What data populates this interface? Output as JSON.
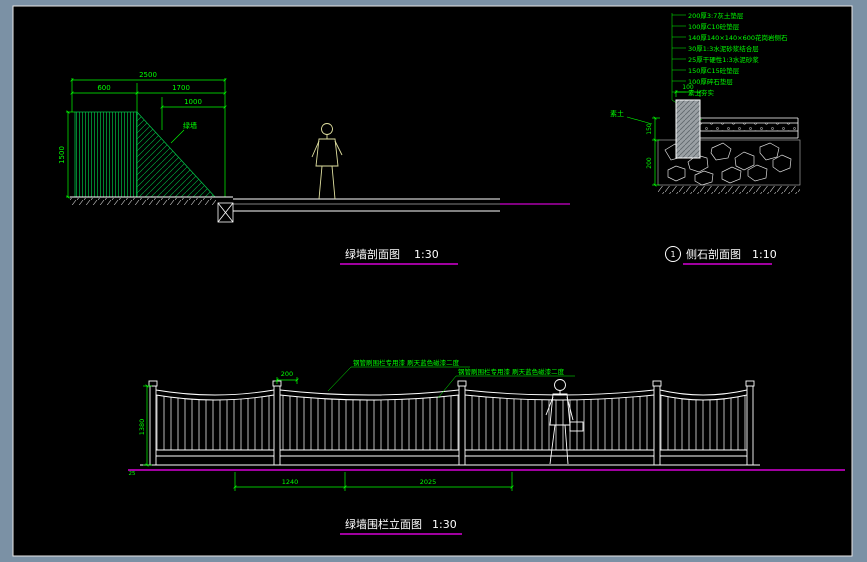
{
  "colors": {
    "frame": "#7b91a5",
    "canvas": "#000000",
    "geometry": "#ffffff",
    "dimension_green": "#00ff00",
    "hatch_green": "#00bb44",
    "baseline_magenta": "#ff00ff",
    "person_yellow": "#e0e0a0"
  },
  "wall": {
    "caption": "绿墙剖面图",
    "scale": "1:30",
    "label": "绿墙",
    "dims": {
      "total": "2500",
      "left_seg": "600",
      "right_seg": "1700",
      "slope": "1000",
      "height": "1500"
    }
  },
  "curb": {
    "caption": "侧石剖面图",
    "scale": "1:10",
    "bubble": "1",
    "soil_label": "素土",
    "dims": {
      "stone_top": "100",
      "layer_upper": "150",
      "layer_lower": "200"
    },
    "notes": [
      "200厚3:7灰土垫层",
      "100厚C10砼垫层",
      "140厚140×140×600花岗岩侧石",
      "30厚1:3水泥砂浆结合层",
      "25厚干硬性1:3水泥砂浆",
      "150厚C15砼垫层",
      "100厚碎石垫层",
      "素土夯实"
    ]
  },
  "fence": {
    "caption": "绿墙围栏立面图",
    "scale": "1:30",
    "notes": [
      "钢管刷围栏专用漆 刷天蓝色磁漆二度",
      "钢管刷围栏专用漆 刷天蓝色磁漆二度"
    ],
    "dims": {
      "post": "200",
      "height": "1380",
      "bay1": "1240",
      "bay2": "2025",
      "base": "25"
    }
  }
}
